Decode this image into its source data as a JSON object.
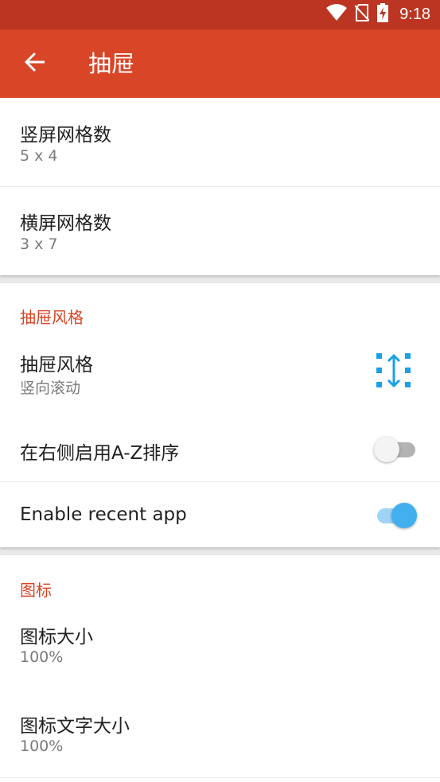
{
  "status_bar": {
    "time": "9:18",
    "icons": [
      "wifi-icon",
      "no-sim-icon",
      "battery-charging-icon"
    ]
  },
  "app_bar": {
    "title": "抽屉",
    "back_icon": "arrow-back-icon",
    "color": "#d84527",
    "status_color": "#bb3522"
  },
  "grid_card": {
    "portrait": {
      "title": "竖屏网格数",
      "value": "5 x 4"
    },
    "landscape": {
      "title": "横屏网格数",
      "value": "3 x 7"
    }
  },
  "drawer_style_section": {
    "header": "抽屉风格",
    "style_item": {
      "title": "抽屉风格",
      "value": "竖向滚动",
      "icon": "vertical-scroll-grid-icon"
    },
    "az_sort": {
      "title": "在右侧启用A-Z排序",
      "enabled": false
    },
    "recent_app": {
      "title": "Enable recent app",
      "enabled": true
    }
  },
  "icon_section": {
    "header": "图标",
    "icon_size": {
      "title": "图标大小",
      "value": "100%"
    },
    "icon_text_size": {
      "title": "图标文字大小",
      "value": "100%"
    }
  },
  "colors": {
    "accent": "#42b0ef",
    "section_header": "#d84527"
  }
}
